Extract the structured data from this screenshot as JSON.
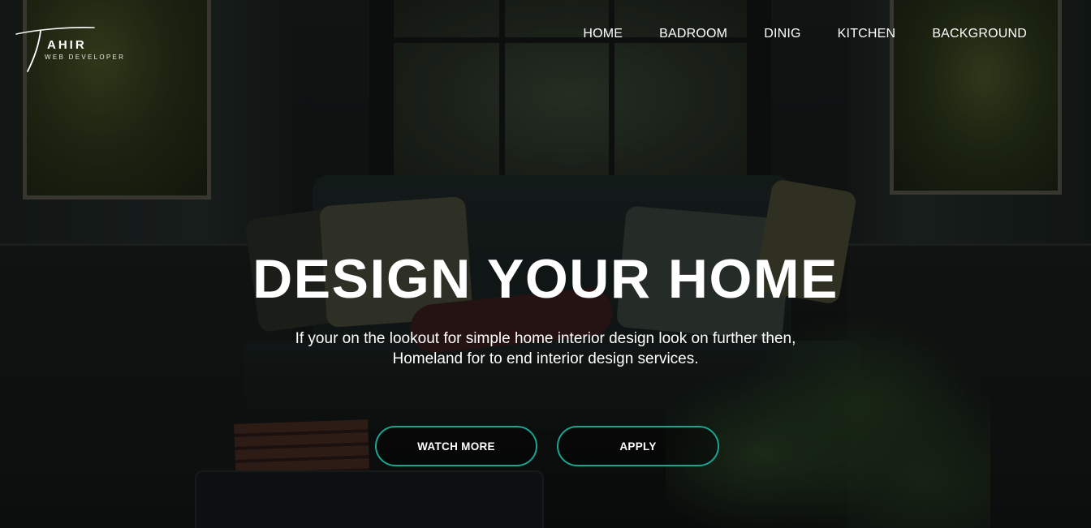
{
  "brand": {
    "name": "AHIR",
    "initial": "T",
    "tagline": "WEB DEVELOPER"
  },
  "nav": {
    "items": [
      {
        "label": "HOME"
      },
      {
        "label": "BADROOM"
      },
      {
        "label": "DINIG"
      },
      {
        "label": "KITCHEN"
      },
      {
        "label": "BACKGROUND"
      }
    ]
  },
  "hero": {
    "title": "DESIGN YOUR HOME",
    "text_line1": "If your on the lookout for simple home interior design look on further then,",
    "text_line2": "Homeland for to end interior design services.",
    "buttons": {
      "watch_more": "WATCH MORE",
      "apply": "APPLY"
    }
  },
  "colors": {
    "accent": "#1aa593",
    "text": "#ffffff"
  }
}
